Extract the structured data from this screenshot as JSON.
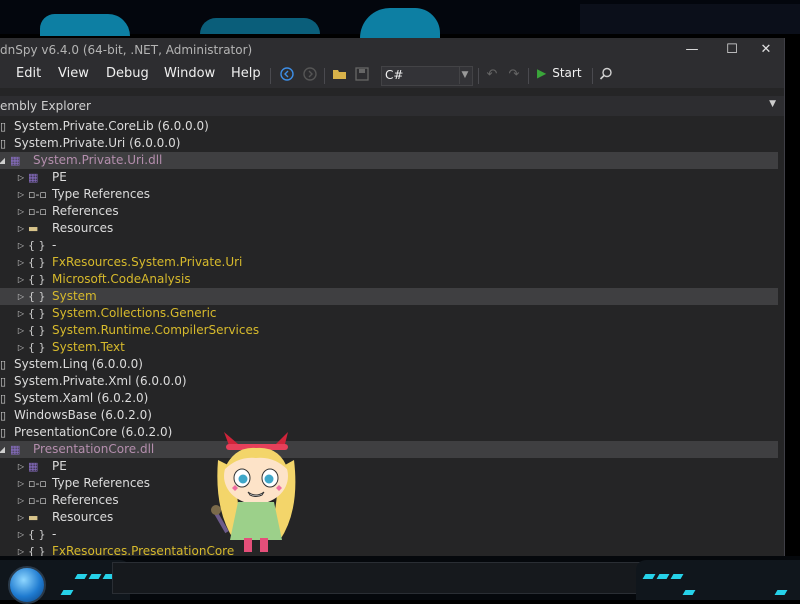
{
  "window": {
    "title": "dnSpy v6.4.0 (64-bit, .NET, Administrator)",
    "controls": {
      "minimize": "—",
      "maximize": "☐",
      "close": "✕"
    }
  },
  "menu": [
    "Edit",
    "View",
    "Debug",
    "Window",
    "Help"
  ],
  "toolbar": {
    "language": "C#",
    "start_label": "Start",
    "icons": [
      "back-icon",
      "forward-icon",
      "open-icon",
      "save-icon",
      "undo-icon",
      "redo-icon",
      "start-icon",
      "search-icon"
    ]
  },
  "panel": {
    "title": "embly Explorer"
  },
  "tree": [
    {
      "depth": 0,
      "expander": "",
      "icon": "assembly",
      "label": "System.Private.CoreLib (6.0.0.0)",
      "color": "#dcdcdc",
      "selected": false
    },
    {
      "depth": 0,
      "expander": "",
      "icon": "assembly",
      "label": "System.Private.Uri (6.0.0.0)",
      "color": "#dcdcdc",
      "selected": false
    },
    {
      "depth": 0,
      "expander": "open",
      "icon": "module",
      "label": "System.Private.Uri.dll",
      "color": "#b48ead",
      "selected": true
    },
    {
      "depth": 1,
      "expander": "closed",
      "icon": "pe",
      "label": "PE",
      "color": "#dcdcdc",
      "selected": false
    },
    {
      "depth": 1,
      "expander": "closed",
      "icon": "ref",
      "label": "Type References",
      "color": "#dcdcdc",
      "selected": false
    },
    {
      "depth": 1,
      "expander": "closed",
      "icon": "ref",
      "label": "References",
      "color": "#dcdcdc",
      "selected": false
    },
    {
      "depth": 1,
      "expander": "closed",
      "icon": "folder",
      "label": "Resources",
      "color": "#dcdcdc",
      "selected": false
    },
    {
      "depth": 1,
      "expander": "closed",
      "icon": "ns",
      "label": "-",
      "color": "#dcdcdc",
      "selected": false
    },
    {
      "depth": 1,
      "expander": "closed",
      "icon": "ns",
      "label": "FxResources.System.Private.Uri",
      "color": "#d7ba2c",
      "selected": false
    },
    {
      "depth": 1,
      "expander": "closed",
      "icon": "ns",
      "label": "Microsoft.CodeAnalysis",
      "color": "#d7ba2c",
      "selected": false
    },
    {
      "depth": 1,
      "expander": "closed",
      "icon": "ns",
      "label": "System",
      "color": "#d7ba2c",
      "selected": true
    },
    {
      "depth": 1,
      "expander": "closed",
      "icon": "ns",
      "label": "System.Collections.Generic",
      "color": "#d7ba2c",
      "selected": false
    },
    {
      "depth": 1,
      "expander": "closed",
      "icon": "ns",
      "label": "System.Runtime.CompilerServices",
      "color": "#d7ba2c",
      "selected": false
    },
    {
      "depth": 1,
      "expander": "closed",
      "icon": "ns",
      "label": "System.Text",
      "color": "#d7ba2c",
      "selected": false
    },
    {
      "depth": 0,
      "expander": "",
      "icon": "assembly",
      "label": "System.Linq (6.0.0.0)",
      "color": "#dcdcdc",
      "selected": false
    },
    {
      "depth": 0,
      "expander": "",
      "icon": "assembly",
      "label": "System.Private.Xml (6.0.0.0)",
      "color": "#dcdcdc",
      "selected": false
    },
    {
      "depth": 0,
      "expander": "",
      "icon": "assembly",
      "label": "System.Xaml (6.0.2.0)",
      "color": "#dcdcdc",
      "selected": false
    },
    {
      "depth": 0,
      "expander": "",
      "icon": "assembly",
      "label": "WindowsBase (6.0.2.0)",
      "color": "#dcdcdc",
      "selected": false
    },
    {
      "depth": 0,
      "expander": "",
      "icon": "assembly",
      "label": "PresentationCore (6.0.2.0)",
      "color": "#dcdcdc",
      "selected": false
    },
    {
      "depth": 0,
      "expander": "open",
      "icon": "module",
      "label": "PresentationCore.dll",
      "color": "#b48ead",
      "selected": true
    },
    {
      "depth": 1,
      "expander": "closed",
      "icon": "pe",
      "label": "PE",
      "color": "#dcdcdc",
      "selected": false
    },
    {
      "depth": 1,
      "expander": "closed",
      "icon": "ref",
      "label": "Type References",
      "color": "#dcdcdc",
      "selected": false
    },
    {
      "depth": 1,
      "expander": "closed",
      "icon": "ref",
      "label": "References",
      "color": "#dcdcdc",
      "selected": false
    },
    {
      "depth": 1,
      "expander": "closed",
      "icon": "folder",
      "label": "Resources",
      "color": "#dcdcdc",
      "selected": false
    },
    {
      "depth": 1,
      "expander": "closed",
      "icon": "ns",
      "label": "-",
      "color": "#dcdcdc",
      "selected": false
    },
    {
      "depth": 1,
      "expander": "closed",
      "icon": "ns",
      "label": "FxResources.PresentationCore",
      "color": "#d7ba2c",
      "selected": false
    }
  ],
  "colors": {
    "background": "#252526",
    "namespace": "#d7ba2c",
    "module": "#b48ead",
    "selection": "#3f3f41",
    "accent": "#26d1e8"
  }
}
